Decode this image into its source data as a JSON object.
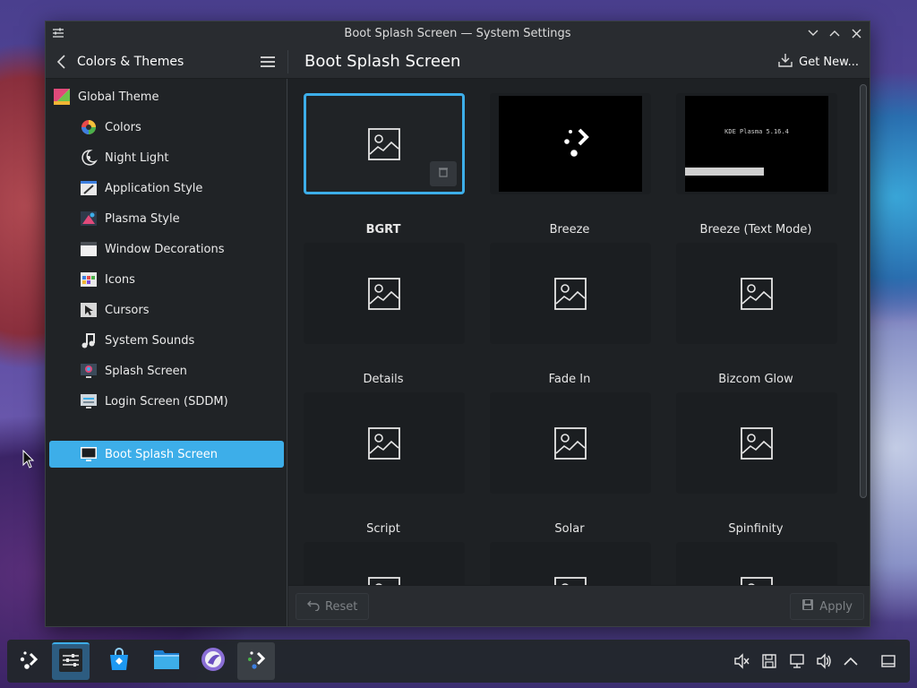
{
  "window": {
    "title": "Boot Splash Screen — System Settings",
    "app_icon": "sliders-icon",
    "controls": [
      "minimize-icon",
      "maximize-icon",
      "close-icon"
    ]
  },
  "header": {
    "back_label": "Colors & Themes",
    "menu_icon": "hamburger-icon",
    "page_title": "Boot Splash Screen",
    "get_new_label": "Get New..."
  },
  "sidebar": {
    "items": [
      {
        "label": "Global Theme",
        "icon": "global-theme-icon",
        "level": "top",
        "selected": false
      },
      {
        "label": "Colors",
        "icon": "colors-icon",
        "level": "sub",
        "selected": false
      },
      {
        "label": "Night Light",
        "icon": "night-light-icon",
        "level": "sub",
        "selected": false
      },
      {
        "label": "Application Style",
        "icon": "application-style-icon",
        "level": "sub",
        "selected": false
      },
      {
        "label": "Plasma Style",
        "icon": "plasma-style-icon",
        "level": "sub",
        "selected": false
      },
      {
        "label": "Window Decorations",
        "icon": "window-decorations-icon",
        "level": "sub",
        "selected": false
      },
      {
        "label": "Icons",
        "icon": "icons-icon",
        "level": "sub",
        "selected": false
      },
      {
        "label": "Cursors",
        "icon": "cursors-icon",
        "level": "sub",
        "selected": false
      },
      {
        "label": "System Sounds",
        "icon": "music-note-icon",
        "level": "sub",
        "selected": false
      },
      {
        "label": "Splash Screen",
        "icon": "splash-screen-icon",
        "level": "sub",
        "selected": false
      },
      {
        "label": "Login Screen (SDDM)",
        "icon": "login-screen-icon",
        "level": "sub",
        "selected": false
      },
      {
        "label": "Boot Splash Screen",
        "icon": "monitor-icon",
        "level": "sub",
        "selected": true
      }
    ]
  },
  "themes": [
    {
      "name": "BGRT",
      "thumbnail": "placeholder",
      "selected": true
    },
    {
      "name": "Breeze",
      "thumbnail": "breeze-logo",
      "selected": false
    },
    {
      "name": "Breeze (Text Mode)",
      "thumbnail": "text-mode",
      "thumb_text": "KDE Plasma 5.16.4",
      "selected": false
    },
    {
      "name": "Details",
      "thumbnail": "placeholder",
      "selected": false
    },
    {
      "name": "Fade In",
      "thumbnail": "placeholder",
      "selected": false
    },
    {
      "name": "Bizcom Glow",
      "thumbnail": "placeholder",
      "selected": false
    },
    {
      "name": "Script",
      "thumbnail": "placeholder",
      "selected": false
    },
    {
      "name": "Solar",
      "thumbnail": "placeholder",
      "selected": false
    },
    {
      "name": "Spinfinity",
      "thumbnail": "placeholder",
      "selected": false
    },
    {
      "name": "",
      "thumbnail": "placeholder",
      "selected": false
    },
    {
      "name": "",
      "thumbnail": "placeholder",
      "selected": false
    },
    {
      "name": "",
      "thumbnail": "placeholder",
      "selected": false
    }
  ],
  "footer": {
    "reset_label": "Reset",
    "apply_label": "Apply"
  },
  "taskbar": {
    "items": [
      {
        "name": "application-launcher",
        "icon": "kde-launcher-icon"
      },
      {
        "name": "system-settings",
        "icon": "sliders-icon",
        "state": "active"
      },
      {
        "name": "discover",
        "icon": "shopping-bag-icon"
      },
      {
        "name": "file-manager",
        "icon": "folder-icon"
      },
      {
        "name": "browser",
        "icon": "browser-icon"
      },
      {
        "name": "splash-preview",
        "icon": "kde-launcher-icon",
        "state": "open"
      }
    ],
    "tray": [
      "volume-muted-icon",
      "save-icon",
      "network-icon",
      "volume-icon",
      "chevron-up-icon",
      "show-desktop-icon"
    ]
  },
  "colors": {
    "accent": "#3daee9",
    "window_bg": "#202326",
    "header_bg": "#292c30"
  }
}
